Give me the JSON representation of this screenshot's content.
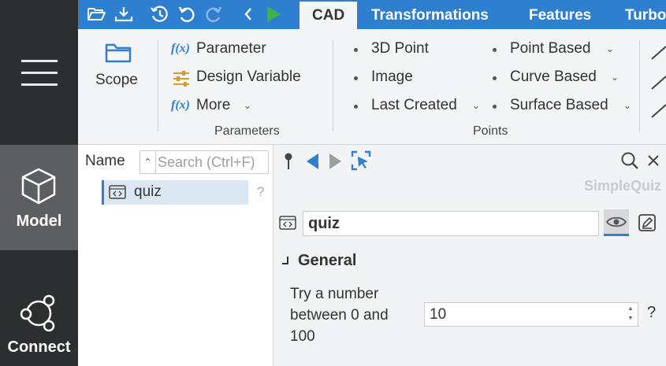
{
  "toolbar": {
    "tabs": [
      {
        "label": "CAD"
      },
      {
        "label": "Transformations"
      },
      {
        "label": "Features"
      },
      {
        "label": "Turbo"
      }
    ]
  },
  "ribbon": {
    "scope_label": "Scope",
    "parameters": {
      "items": [
        "Parameter",
        "Design Variable",
        "More"
      ],
      "fx_glyph": "f(x)",
      "group_label": "Parameters"
    },
    "points": {
      "col1": [
        "3D Point",
        "Image",
        "Last Created"
      ],
      "col2": [
        "Point Based",
        "Curve Based",
        "Surface Based"
      ],
      "group_label": "Points"
    }
  },
  "sidebar": {
    "items": [
      {
        "label": "Model",
        "icon": "cube-icon"
      },
      {
        "label": "Connect",
        "icon": "graph-icon"
      }
    ]
  },
  "tree": {
    "header": "Name",
    "search_placeholder": "Search (Ctrl+F)",
    "items": [
      {
        "label": "quiz",
        "help": "?"
      }
    ]
  },
  "properties": {
    "brand": "SimpleQuiz",
    "name_value": "quiz",
    "section": "General",
    "field_label": "Try a number between 0 and 100",
    "field_value": "10",
    "help": "?"
  },
  "colors": {
    "accent": "#2f7fd0",
    "rail": "#2d2e30",
    "rail_active": "#5d5e61",
    "run_green": "#3cb34a"
  }
}
